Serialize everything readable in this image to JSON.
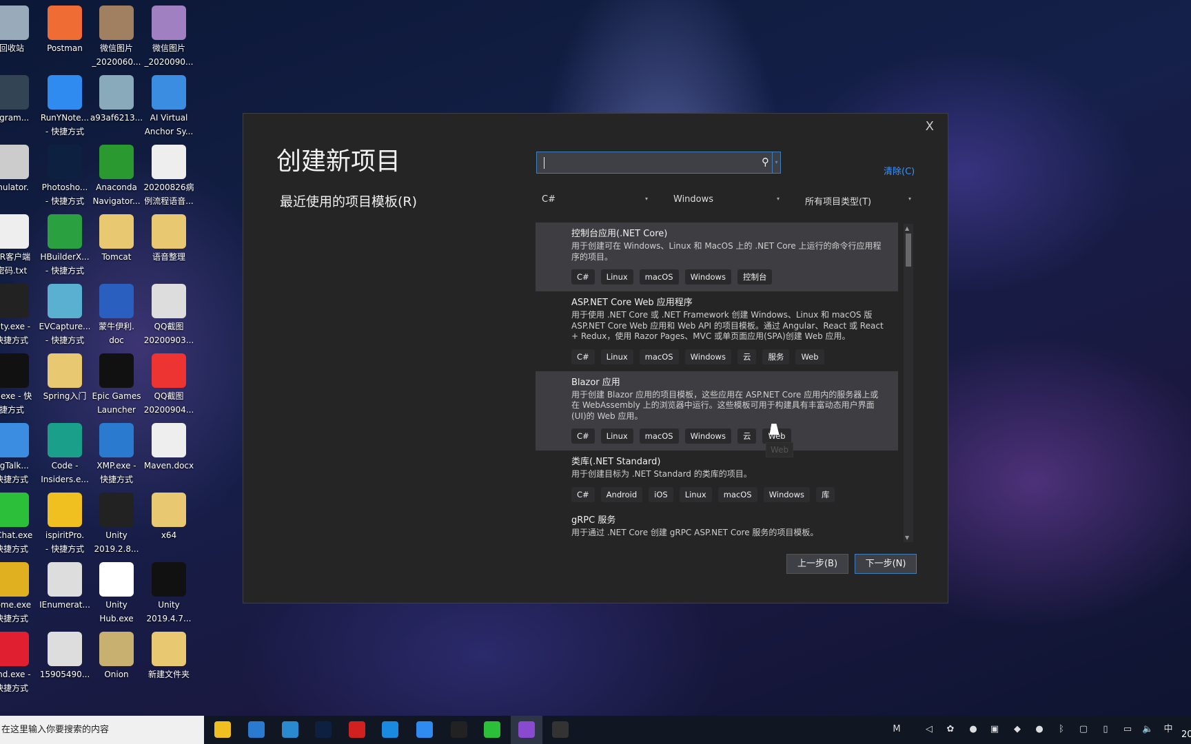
{
  "desktop": {
    "icons": [
      [
        "回收站",
        "",
        "#9ab"
      ],
      [
        "ogram...",
        "",
        "#345"
      ],
      [
        "mulator.",
        "",
        "#ccc"
      ],
      [
        "wR客户端",
        "密码.txt",
        "#eee"
      ],
      [
        "nity.exe -",
        "快捷方式",
        "#222"
      ],
      [
        "Q.exe - 快",
        "捷方式",
        "#111"
      ],
      [
        "ngTalk...",
        "快捷方式",
        "#3a8de0"
      ],
      [
        "eChat.exe",
        "快捷方式",
        "#2bbf3a"
      ],
      [
        "rome.exe",
        "快捷方式",
        "#e0b020"
      ],
      [
        "lind.exe -",
        "快捷方式",
        "#e02030"
      ],
      [
        "Postman",
        "",
        "#ef6c35"
      ],
      [
        "RunYNote...",
        "- 快捷方式",
        "#2f8bf0"
      ],
      [
        "Photosho...",
        "- 快捷方式",
        "#0d2040"
      ],
      [
        "HBuilderX...",
        "- 快捷方式",
        "#2aa040"
      ],
      [
        "EVCapture...",
        "- 快捷方式",
        "#5ab0d0"
      ],
      [
        "Spring入门",
        "",
        "#e8c870"
      ],
      [
        "Code -",
        "Insiders.e...",
        "#1aa08a"
      ],
      [
        "ispiritPro.",
        "- 快捷方式",
        "#f0c020"
      ],
      [
        "IEnumerat...",
        "",
        "#ddd"
      ],
      [
        "15905490...",
        "",
        "#ddd"
      ],
      [
        "微信图片",
        "_2020060...",
        "#a08060"
      ],
      [
        "a93af6213...",
        "",
        "#8ab"
      ],
      [
        "Anaconda",
        "Navigator...",
        "#2a9a30"
      ],
      [
        "Tomcat",
        "",
        "#e8c870"
      ],
      [
        "蒙牛伊利.",
        "doc",
        "#2b5fbf"
      ],
      [
        "Epic Games",
        "Launcher",
        "#111"
      ],
      [
        "XMP.exe -",
        "快捷方式",
        "#2a7ad0"
      ],
      [
        "Unity",
        "2019.2.8...",
        "#222"
      ],
      [
        "Unity",
        "Hub.exe",
        "#fff"
      ],
      [
        "Onion",
        "",
        "#c8b070"
      ],
      [
        "微信图片",
        "_2020090...",
        "#a080c0"
      ],
      [
        "AI Virtual",
        "Anchor Sy...",
        "#3a8de0"
      ],
      [
        "20200826病",
        "例流程语音...",
        "#eee"
      ],
      [
        "语音整理",
        "",
        "#e8c870"
      ],
      [
        "QQ截图",
        "20200903...",
        "#ddd"
      ],
      [
        "QQ截图",
        "20200904...",
        "#e33"
      ],
      [
        "Maven.docx",
        "",
        "#eee"
      ],
      [
        "x64",
        "",
        "#e8c870"
      ],
      [
        "Unity",
        "2019.4.7...",
        "#111"
      ],
      [
        "新建文件夹",
        "",
        "#e8c870"
      ]
    ]
  },
  "dialog": {
    "title": "创建新项目",
    "recent_label": "最近使用的项目模板(R)",
    "close": "X",
    "search": {
      "value": "",
      "icon": "search-icon"
    },
    "clear": "清除(C)",
    "filters": {
      "language": "C#",
      "platform": "Windows",
      "project_type": "所有项目类型(T)"
    },
    "templates": [
      {
        "name": "控制台应用(.NET Core)",
        "desc": "用于创建可在 Windows、Linux 和 MacOS 上的 .NET Core 上运行的命令行应用程序的项目。",
        "tags": [
          "C#",
          "Linux",
          "macOS",
          "Windows",
          "控制台"
        ],
        "highlighted": true
      },
      {
        "name": "ASP.NET Core Web 应用程序",
        "desc": "用于使用 .NET Core 或 .NET Framework 创建 Windows、Linux 和 macOS 版 ASP.NET Core Web 应用和 Web API 的项目模板。通过 Angular、React 或 React + Redux，使用 Razor Pages、MVC 或单页面应用(SPA)创建 Web 应用。",
        "tags": [
          "C#",
          "Linux",
          "macOS",
          "Windows",
          "云",
          "服务",
          "Web"
        ]
      },
      {
        "name": "Blazor 应用",
        "desc": "用于创建 Blazor 应用的项目模板，这些应用在 ASP.NET Core 应用内的服务器上或在 WebAssembly 上的浏览器中运行。这些模板可用于构建具有丰富动态用户界面(UI)的 Web 应用。",
        "tags": [
          "C#",
          "Linux",
          "macOS",
          "Windows",
          "云",
          "Web"
        ],
        "highlighted": true
      },
      {
        "name": "类库(.NET Standard)",
        "desc": "用于创建目标为 .NET Standard 的类库的项目。",
        "tags": [
          "C#",
          "Android",
          "iOS",
          "Linux",
          "macOS",
          "Windows",
          "库"
        ]
      },
      {
        "name": "gRPC 服务",
        "desc": "用于通过 .NET Core 创建 gRPC ASP.NET Core 服务的项目模板。",
        "tags": [
          "C#",
          "Linux",
          "macOS",
          "Windows",
          "云",
          "服务",
          "Web"
        ]
      }
    ],
    "tooltip": "Web",
    "back_button": "上一步(B)",
    "next_button": "下一步(N)"
  },
  "taskbar": {
    "search_placeholder": "在这里输入你要搜索的内容",
    "apps": [
      [
        "sticky-notes",
        "#f0c020"
      ],
      [
        "kugou",
        "#2a7ad0"
      ],
      [
        "telegram",
        "#2a8ad0"
      ],
      [
        "photoshop",
        "#0d2040"
      ],
      [
        "youdao",
        "#d02020"
      ],
      [
        "qq-browser",
        "#1a8ae0"
      ],
      [
        "runynote",
        "#2f8bf0"
      ],
      [
        "unity",
        "#222"
      ],
      [
        "wechat",
        "#2bbf3a"
      ],
      [
        "visual-studio",
        "#8a4ad0"
      ],
      [
        "unity-hub",
        "#333"
      ]
    ],
    "tray": [
      [
        "M",
        "m-icon"
      ],
      [
        "◁",
        "unity-tray-icon"
      ],
      [
        "✿",
        "flower-icon"
      ],
      [
        "●",
        "qq-icon"
      ],
      [
        "▣",
        "remote-icon"
      ],
      [
        "◆",
        "runynote-tray-icon"
      ],
      [
        "●",
        "wechat-tray-icon"
      ],
      [
        "ᛒ",
        "bluetooth-icon"
      ],
      [
        "▢",
        "display-alert-icon"
      ],
      [
        "▯",
        "usb-icon"
      ],
      [
        "▭",
        "network-icon"
      ],
      [
        "🔈",
        "volume-icon"
      ],
      [
        "中",
        "ime-indicator"
      ]
    ],
    "clock": "20"
  }
}
